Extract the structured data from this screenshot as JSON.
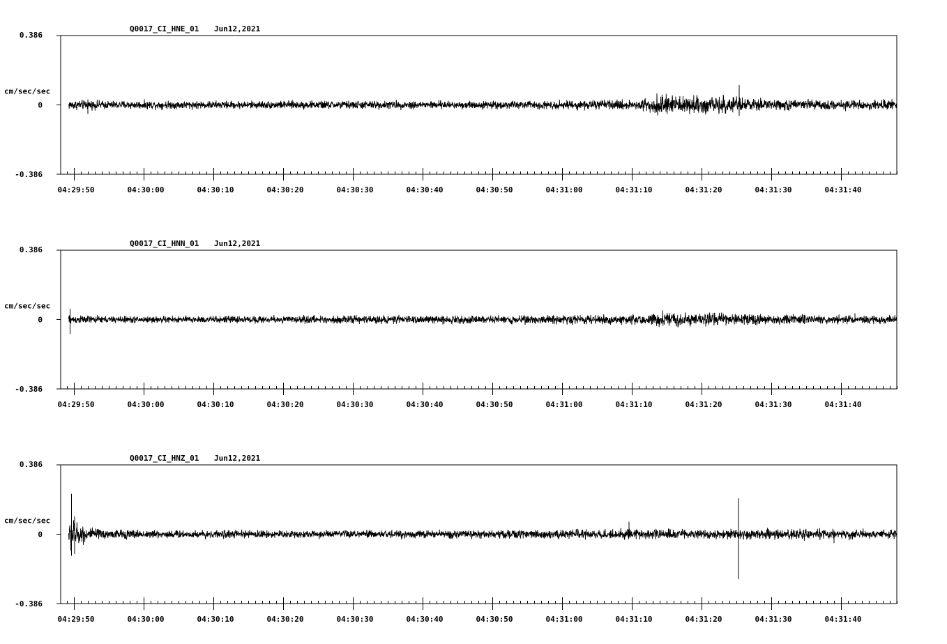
{
  "chart_data": [
    {
      "type": "line",
      "title": "Q0017_CI_HNE_01",
      "date": "Jun12,2021",
      "ylabel": "cm/sec/sec",
      "ylim": [
        -0.386,
        0.386
      ],
      "y_tick_labels": [
        "0.386",
        "0",
        "-0.386"
      ],
      "x_tick_labels": [
        "04:29:50",
        "04:30:00",
        "04:30:10",
        "04:30:20",
        "04:30:30",
        "04:30:40",
        "04:30:50",
        "04:31:00",
        "04:31:10",
        "04:31:20",
        "04:31:30",
        "04:31:40"
      ],
      "xlim_seconds_after_first_tick": [
        -1.9,
        118.0
      ],
      "trace_start_seconds": -0.75,
      "envelope": {
        "t": [
          -0.75,
          0,
          5,
          20,
          40,
          60,
          80,
          83,
          84.5,
          88,
          93,
          95,
          100,
          110,
          118
        ],
        "amp": [
          0.035,
          0.035,
          0.03,
          0.028,
          0.03,
          0.028,
          0.035,
          0.06,
          0.07,
          0.06,
          0.065,
          0.05,
          0.04,
          0.035,
          0.035
        ]
      },
      "spikes": [
        {
          "t": 95.4,
          "max": 0.11,
          "min": -0.06
        },
        {
          "t": 2.0,
          "max": 0.03,
          "min": -0.05
        }
      ]
    },
    {
      "type": "line",
      "title": "Q0017_CI_HNN_01",
      "date": "Jun12,2021",
      "ylabel": "cm/sec/sec",
      "ylim": [
        -0.386,
        0.386
      ],
      "y_tick_labels": [
        "0.386",
        "0",
        "-0.386"
      ],
      "x_tick_labels": [
        "04:29:50",
        "04:30:00",
        "04:30:10",
        "04:30:20",
        "04:30:30",
        "04:30:40",
        "04:30:50",
        "04:31:00",
        "04:31:10",
        "04:31:20",
        "04:31:30",
        "04:31:40"
      ],
      "xlim_seconds_after_first_tick": [
        -1.9,
        118.0
      ],
      "trace_start_seconds": -0.75,
      "envelope": {
        "t": [
          -0.75,
          0,
          5,
          20,
          40,
          60,
          80,
          85,
          88,
          95,
          100,
          110,
          118
        ],
        "amp": [
          0.035,
          0.03,
          0.025,
          0.025,
          0.028,
          0.028,
          0.035,
          0.055,
          0.05,
          0.04,
          0.035,
          0.03,
          0.03
        ]
      },
      "spikes": [
        {
          "t": -0.55,
          "max": 0.06,
          "min": -0.08
        },
        {
          "t": 112.0,
          "max": 0.035,
          "min": -0.015
        }
      ]
    },
    {
      "type": "line",
      "title": "Q0017_CI_HNZ_01",
      "date": "Jun12,2021",
      "ylabel": "cm/sec/sec",
      "ylim": [
        -0.386,
        0.386
      ],
      "y_tick_labels": [
        "0.386",
        "0",
        "-0.386"
      ],
      "x_tick_labels": [
        "04:29:50",
        "04:30:00",
        "04:30:10",
        "04:30:20",
        "04:30:30",
        "04:30:40",
        "04:30:50",
        "04:31:00",
        "04:31:10",
        "04:31:20",
        "04:31:30",
        "04:31:40"
      ],
      "xlim_seconds_after_first_tick": [
        -1.9,
        118.0
      ],
      "trace_start_seconds": -0.75,
      "envelope": {
        "t": [
          -0.75,
          -0.4,
          0.5,
          2,
          4,
          7,
          10,
          20,
          40,
          60,
          78,
          80,
          90,
          100,
          110,
          118
        ],
        "amp": [
          0.09,
          0.12,
          0.08,
          0.05,
          0.035,
          0.035,
          0.03,
          0.028,
          0.028,
          0.03,
          0.035,
          0.035,
          0.035,
          0.035,
          0.035,
          0.035
        ]
      },
      "spikes": [
        {
          "t": -0.35,
          "max": 0.225,
          "min": -0.12
        },
        {
          "t": 0.1,
          "max": 0.1,
          "min": -0.11
        },
        {
          "t": 95.3,
          "max": 0.2,
          "min": -0.25
        },
        {
          "t": 79.6,
          "max": 0.07,
          "min": -0.02
        },
        {
          "t": 109.0,
          "max": 0.02,
          "min": -0.05
        }
      ]
    }
  ]
}
